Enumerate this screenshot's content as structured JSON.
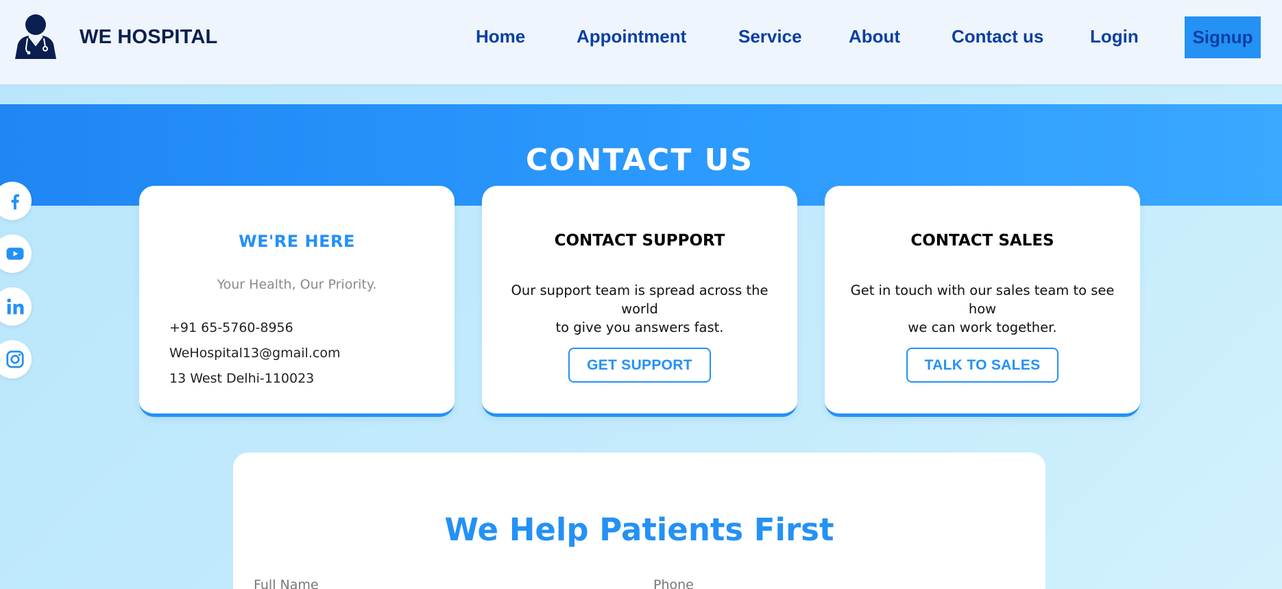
{
  "header": {
    "brand": "WE HOSPITAL",
    "nav": [
      {
        "label": "Home"
      },
      {
        "label": "Appointment"
      },
      {
        "label": "Service"
      },
      {
        "label": "About"
      },
      {
        "label": "Contact us"
      },
      {
        "label": "Login"
      }
    ],
    "signup_label": "Signup"
  },
  "banner": {
    "title": "CONTACT US"
  },
  "social": [
    "facebook-icon",
    "youtube-icon",
    "linkedin-icon",
    "instagram-icon"
  ],
  "cards": {
    "here": {
      "title": "WE'RE HERE",
      "subtitle": "Your Health, Our Priority.",
      "phone": "+91 65-5760-8956",
      "email": "WeHospital13@gmail.com",
      "address": "13 West Delhi-110023"
    },
    "support": {
      "title": "CONTACT SUPPORT",
      "desc_line1": "Our support team is spread across the world",
      "desc_line2": "to give you answers fast.",
      "button": "GET SUPPORT"
    },
    "sales": {
      "title": "CONTACT SALES",
      "desc_line1": "Get in touch with our sales team to see how",
      "desc_line2": "we can work together.",
      "button": "TALK TO SALES"
    }
  },
  "form": {
    "title": "We Help Patients First",
    "full_name_label": "Full Name",
    "phone_label": "Phone"
  },
  "colors": {
    "accent": "#2491f5",
    "nav_text": "#0a3fa3",
    "brand_text": "#0a1f4f",
    "header_bg": "#eef5fc",
    "page_bg": "#c4ebfc"
  }
}
